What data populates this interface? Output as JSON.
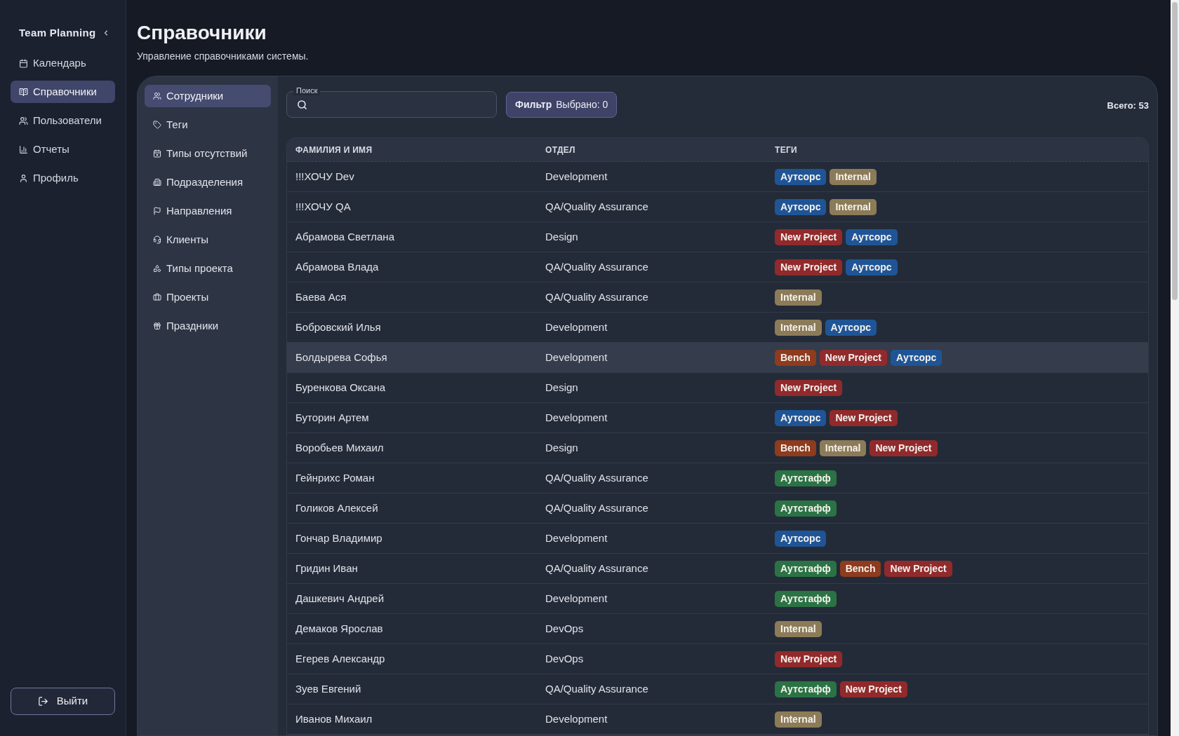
{
  "sidebar": {
    "title": "Team Planning",
    "items": [
      {
        "label": "Календарь",
        "selected": false
      },
      {
        "label": "Справочники",
        "selected": true
      },
      {
        "label": "Пользователи",
        "selected": false
      },
      {
        "label": "Отчеты",
        "selected": false
      },
      {
        "label": "Профиль",
        "selected": false
      }
    ],
    "logout_button": "Выйти"
  },
  "page": {
    "title": "Справочники",
    "subtitle": "Управление справочниками системы."
  },
  "directory_nav": {
    "items": [
      {
        "label": "Сотрудники",
        "selected": true
      },
      {
        "label": "Теги",
        "selected": false
      },
      {
        "label": "Типы отсутствий",
        "selected": false
      },
      {
        "label": "Подразделения",
        "selected": false
      },
      {
        "label": "Направления",
        "selected": false
      },
      {
        "label": "Клиенты",
        "selected": false
      },
      {
        "label": "Типы проекта",
        "selected": false
      },
      {
        "label": "Проекты",
        "selected": false
      },
      {
        "label": "Праздники",
        "selected": false
      }
    ]
  },
  "search": {
    "label": "Поиск"
  },
  "filter_button": {
    "label": "Фильтр",
    "selected_count": "Выбрано: 0"
  },
  "total": "Всего: 53",
  "table": {
    "columns": [
      "ФАМИЛИЯ И ИМЯ",
      "ОТДЕЛ",
      "ТЕГИ"
    ],
    "rows": [
      {
        "name": "!!!ХОЧУ Dev",
        "department": "Development",
        "highlighted": false,
        "tags": [
          {
            "label": "Аутсорс",
            "color": "#1f5597"
          },
          {
            "label": "Internal",
            "color": "#8c7b58"
          }
        ]
      },
      {
        "name": "!!!ХОЧУ QA",
        "department": "QA/Quality Assurance",
        "highlighted": false,
        "tags": [
          {
            "label": "Аутсорс",
            "color": "#1f5597"
          },
          {
            "label": "Internal",
            "color": "#8c7b58"
          }
        ]
      },
      {
        "name": "Абрамова Светлана",
        "department": "Design",
        "highlighted": false,
        "tags": [
          {
            "label": "New Project",
            "color": "#912a2c"
          },
          {
            "label": "Аутсорс",
            "color": "#1f5597"
          }
        ]
      },
      {
        "name": "Абрамова Влада",
        "department": "QA/Quality Assurance",
        "highlighted": false,
        "tags": [
          {
            "label": "New Project",
            "color": "#912a2c"
          },
          {
            "label": "Аутсорс",
            "color": "#1f5597"
          }
        ]
      },
      {
        "name": "Баева Ася",
        "department": "QA/Quality Assurance",
        "highlighted": false,
        "tags": [
          {
            "label": "Internal",
            "color": "#8c7b58"
          }
        ]
      },
      {
        "name": "Бобровский Илья",
        "department": "Development",
        "highlighted": false,
        "tags": [
          {
            "label": "Internal",
            "color": "#8c7b58"
          },
          {
            "label": "Аутсорс",
            "color": "#1f5597"
          }
        ]
      },
      {
        "name": "Болдырева Софья",
        "department": "Development",
        "highlighted": true,
        "tags": [
          {
            "label": "Bench",
            "color": "#8e3b1e"
          },
          {
            "label": "New Project",
            "color": "#912a2c"
          },
          {
            "label": "Аутсорс",
            "color": "#1f5597"
          }
        ]
      },
      {
        "name": "Буренкова Оксана",
        "department": "Design",
        "highlighted": false,
        "tags": [
          {
            "label": "New Project",
            "color": "#912a2c"
          }
        ]
      },
      {
        "name": "Буторин Артем",
        "department": "Development",
        "highlighted": false,
        "tags": [
          {
            "label": "Аутсорс",
            "color": "#1f5597"
          },
          {
            "label": "New Project",
            "color": "#912a2c"
          }
        ]
      },
      {
        "name": "Воробьев Михаил",
        "department": "Design",
        "highlighted": false,
        "tags": [
          {
            "label": "Bench",
            "color": "#8e3b1e"
          },
          {
            "label": "Internal",
            "color": "#8c7b58"
          },
          {
            "label": "New Project",
            "color": "#912a2c"
          }
        ]
      },
      {
        "name": "Гейнрихс Роман",
        "department": "QA/Quality Assurance",
        "highlighted": false,
        "tags": [
          {
            "label": "Аутстафф",
            "color": "#2b7345"
          }
        ]
      },
      {
        "name": "Голиков Алексей",
        "department": "QA/Quality Assurance",
        "highlighted": false,
        "tags": [
          {
            "label": "Аутстафф",
            "color": "#2b7345"
          }
        ]
      },
      {
        "name": "Гончар Владимир",
        "department": "Development",
        "highlighted": false,
        "tags": [
          {
            "label": "Аутсорс",
            "color": "#1f5597"
          }
        ]
      },
      {
        "name": "Гридин Иван",
        "department": "QA/Quality Assurance",
        "highlighted": false,
        "tags": [
          {
            "label": "Аутстафф",
            "color": "#2b7345"
          },
          {
            "label": "Bench",
            "color": "#8e3b1e"
          },
          {
            "label": "New Project",
            "color": "#912a2c"
          }
        ]
      },
      {
        "name": "Дашкевич Андрей",
        "department": "Development",
        "highlighted": false,
        "tags": [
          {
            "label": "Аутстафф",
            "color": "#2b7345"
          }
        ]
      },
      {
        "name": "Демаков Ярослав",
        "department": "DevOps",
        "highlighted": false,
        "tags": [
          {
            "label": "Internal",
            "color": "#8c7b58"
          }
        ]
      },
      {
        "name": "Егерев Александр",
        "department": "DevOps",
        "highlighted": false,
        "tags": [
          {
            "label": "New Project",
            "color": "#912a2c"
          }
        ]
      },
      {
        "name": "Зуев Евгений",
        "department": "QA/Quality Assurance",
        "highlighted": false,
        "tags": [
          {
            "label": "Аутстафф",
            "color": "#2b7345"
          },
          {
            "label": "New Project",
            "color": "#912a2c"
          }
        ]
      },
      {
        "name": "Иванов Михаил",
        "department": "Development",
        "highlighted": false,
        "tags": [
          {
            "label": "Internal",
            "color": "#8c7b58"
          }
        ]
      }
    ]
  }
}
